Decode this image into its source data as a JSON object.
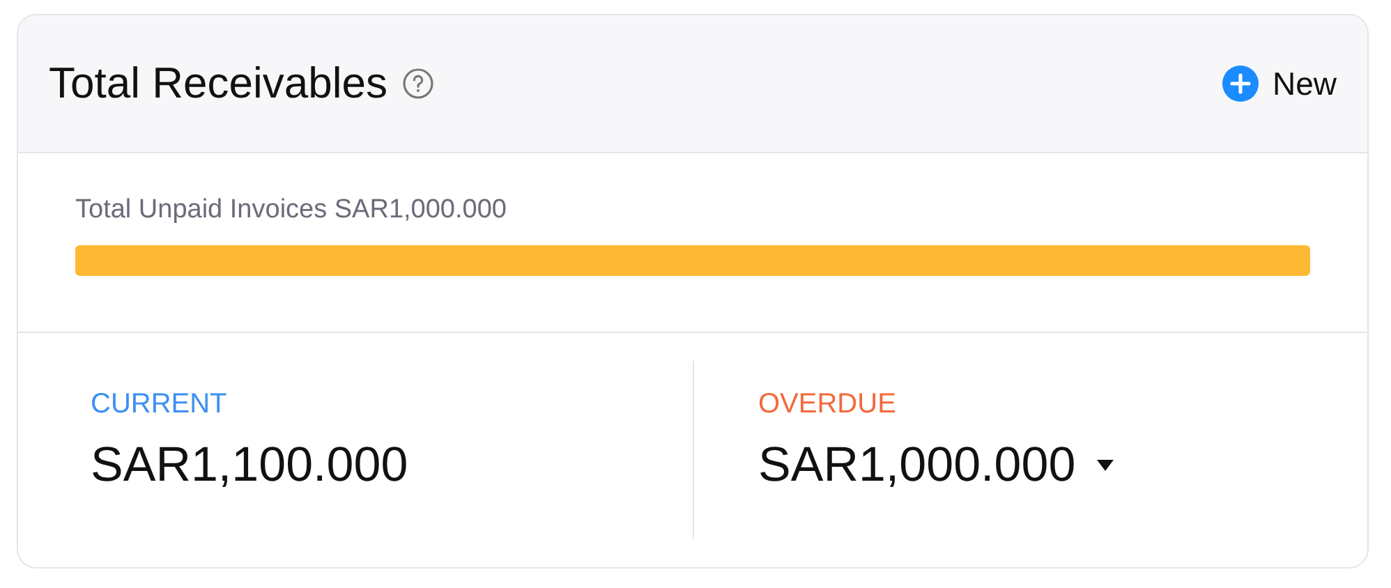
{
  "header": {
    "title": "Total Receivables",
    "new_button": "New"
  },
  "unpaid": {
    "label": "Total Unpaid Invoices SAR1,000.000"
  },
  "summary": [
    {
      "label": "CURRENT",
      "amount": "SAR1,100.000",
      "color": "#3d8ff0",
      "dropdown": false
    },
    {
      "label": "OVERDUE",
      "amount": "SAR1,000.000",
      "color": "#f26a3a",
      "dropdown": true
    }
  ]
}
